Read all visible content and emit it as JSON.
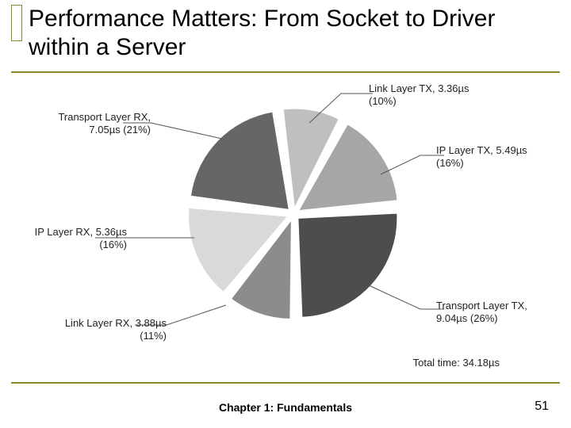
{
  "title": "Performance Matters: From Socket to Driver within a Server",
  "footer": "Chapter 1: Fundamentals",
  "page_number": "51",
  "total_label": "Total time: 34.18µs",
  "labels": {
    "link_tx": {
      "l1": "Link Layer TX, 3.36µs",
      "l2": "(10%)"
    },
    "ip_tx": {
      "l1": "IP Layer TX, 5.49µs",
      "l2": "(16%)"
    },
    "transport_tx": {
      "l1": "Transport Layer TX,",
      "l2": "9.04µs (26%)"
    },
    "link_rx": {
      "l1": "Link Layer RX, 3.88µs",
      "l2": "(11%)"
    },
    "ip_rx": {
      "l1": "IP Layer RX, 5.36µs",
      "l2": "(16%)"
    },
    "transport_rx": {
      "l1": "Transport Layer RX,",
      "l2": "7.05µs (21%)"
    }
  },
  "chart_data": {
    "type": "pie",
    "title": "Performance Matters: From Socket to Driver within a Server",
    "total_us": 34.18,
    "series": [
      {
        "name": "Link Layer TX",
        "value_us": 3.36,
        "percent": 10
      },
      {
        "name": "IP Layer TX",
        "value_us": 5.49,
        "percent": 16
      },
      {
        "name": "Transport Layer TX",
        "value_us": 9.04,
        "percent": 26
      },
      {
        "name": "Link Layer RX",
        "value_us": 3.88,
        "percent": 11
      },
      {
        "name": "IP Layer RX",
        "value_us": 5.36,
        "percent": 16
      },
      {
        "name": "Transport Layer RX",
        "value_us": 7.05,
        "percent": 21
      }
    ],
    "colors": [
      "#bfbfbf",
      "#a6a6a6",
      "#4d4d4d",
      "#8c8c8c",
      "#d9d9d9",
      "#666666"
    ]
  }
}
